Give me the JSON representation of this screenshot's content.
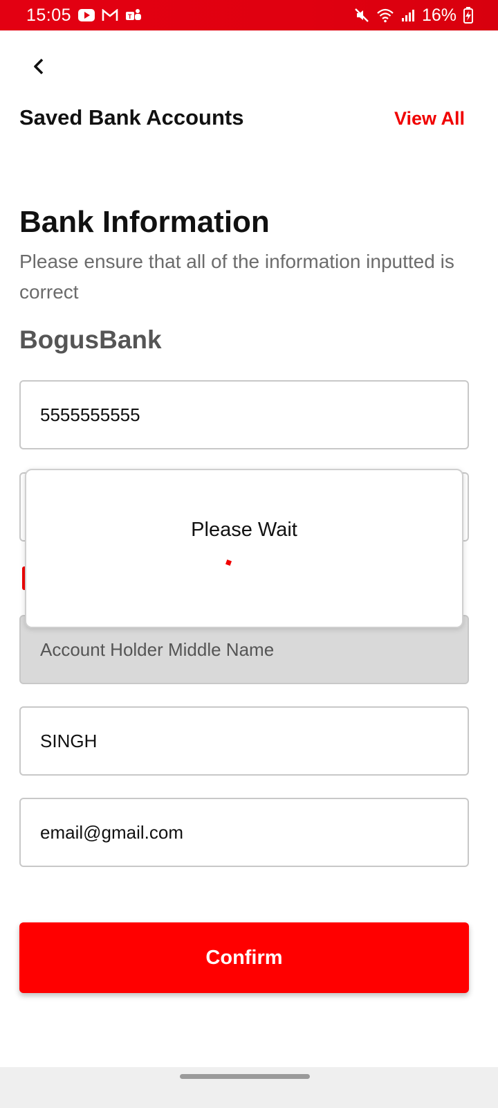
{
  "status_bar": {
    "time": "15:05",
    "battery_percent": "16%",
    "left_icons": [
      "youtube-icon",
      "gmail-icon",
      "teams-icon"
    ],
    "right_icons": [
      "mute-icon",
      "wifi-icon",
      "signal-icon",
      "battery-charging-icon"
    ]
  },
  "header": {
    "saved_title": "Saved Bank Accounts",
    "view_all_label": "View All"
  },
  "bank_info": {
    "title": "Bank Information",
    "subtitle": "Please ensure that all of the information inputted is correct",
    "bank_name": "BogusBank"
  },
  "fields": {
    "account_number": "5555555555",
    "middle_name_placeholder": "Account Holder Middle Name",
    "last_name": "SINGH",
    "email": "email@gmail.com"
  },
  "dialog": {
    "message": "Please Wait"
  },
  "confirm_label": "Confirm",
  "colors": {
    "accent": "#ff0000",
    "status_bar": "#e30012",
    "disabled_field": "#d9d9d9"
  }
}
